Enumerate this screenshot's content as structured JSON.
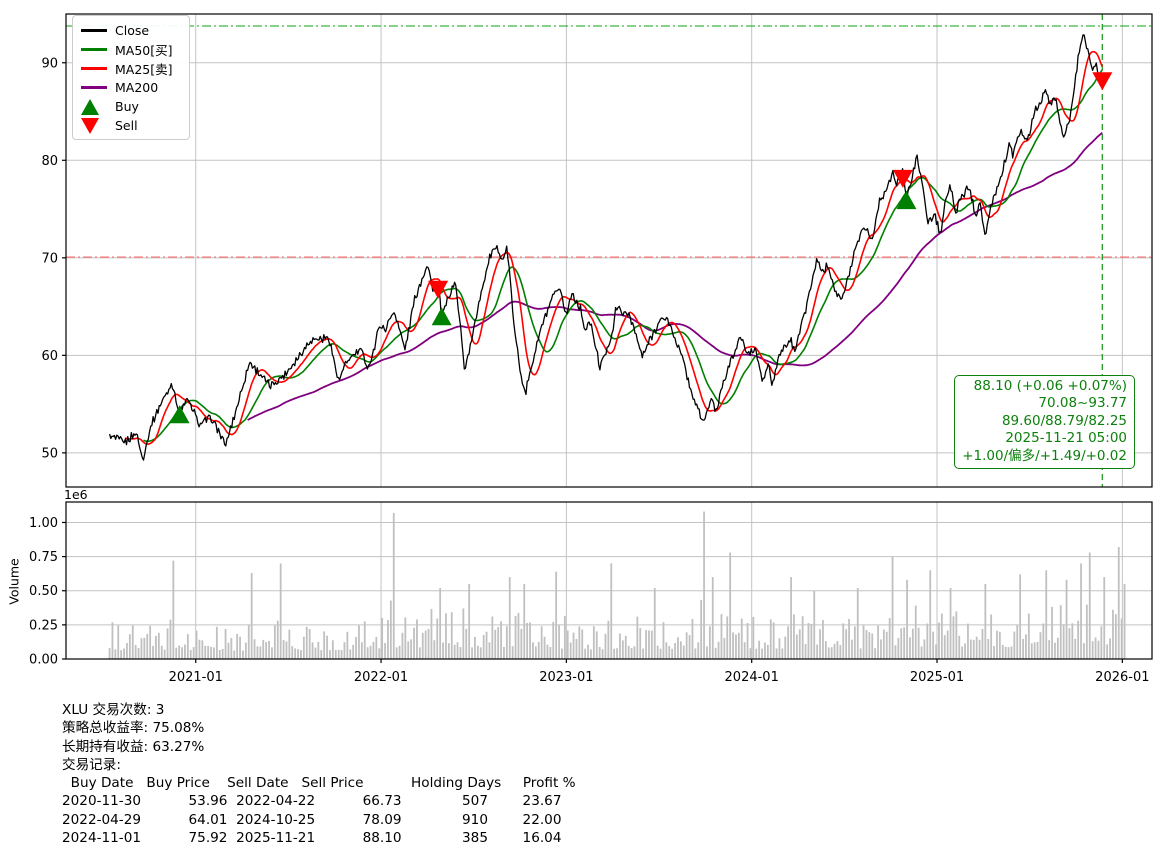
{
  "figure": {
    "bg": "#ffffff"
  },
  "colors": {
    "close": "#000000",
    "ma25": "#ff0000",
    "ma50": "#008000",
    "ma200": "#800080",
    "buy": "#008000",
    "sell": "#ff0000",
    "hline_top": "#00a000",
    "hline_mid": "#ff4040",
    "vline": "#0a8f0a",
    "volume_bar": "#c0c0c0",
    "grid": "#c3c3c3",
    "annotation": "#0d800d"
  },
  "legend": {
    "items": [
      {
        "label": "Close",
        "color": "#000000",
        "type": "line"
      },
      {
        "label": "MA50[买]",
        "color": "#008000",
        "type": "line"
      },
      {
        "label": "MA25[卖]",
        "color": "#ff0000",
        "type": "line"
      },
      {
        "label": "MA200",
        "color": "#800080",
        "type": "line"
      },
      {
        "label": "Buy",
        "color": "#008000",
        "type": "triangle-up"
      },
      {
        "label": "Sell",
        "color": "#ff0000",
        "type": "triangle-down"
      }
    ]
  },
  "annotation": {
    "color": "#0d800d",
    "lines": [
      "88.10 (+0.06 +0.07%)",
      "70.08~93.77",
      "89.60/88.79/82.25",
      "2025-11-21 05:00",
      "+1.00/偏多/+1.49/+0.02"
    ]
  },
  "summary": {
    "lines": [
      "XLU 交易次数: 3",
      "策略总收益率: 75.08%",
      "长期持有收益: 63.27%",
      "交易记录:"
    ]
  },
  "trades": {
    "columns": [
      "Buy Date",
      "Buy Price",
      "Sell Date",
      "Sell Price",
      "Holding Days",
      "Profit %"
    ],
    "rows": [
      [
        "2020-11-30",
        "53.96",
        "2022-04-22",
        "66.73",
        "507",
        "23.67"
      ],
      [
        "2022-04-29",
        "64.01",
        "2024-10-25",
        "78.09",
        "910",
        "22.00"
      ],
      [
        "2024-11-01",
        "75.92",
        "2025-11-21",
        "88.10",
        "385",
        "16.04"
      ]
    ],
    "header_text": "  Buy Date   Buy Price    Sell Date   Sell Price           Holding Days     Profit %",
    "row_texts": [
      "2020-11-30           53.96  2022-04-22           66.73              507        23.67",
      "2022-04-29           64.01  2024-10-25           78.09              910        22.00",
      "2024-11-01           75.92  2025-11-21           88.10              385        16.04"
    ]
  },
  "chart_data": [
    {
      "type": "line",
      "title": "",
      "xlabel": "",
      "ylabel": "",
      "xlim": [
        2020.3,
        2026.16
      ],
      "ylim": [
        46.5,
        95.0
      ],
      "grid": true,
      "legend_position": "upper-left",
      "x_ticks": [
        {
          "pos": 2021,
          "label": "2021-01"
        },
        {
          "pos": 2022,
          "label": "2022-01"
        },
        {
          "pos": 2023,
          "label": "2023-01"
        },
        {
          "pos": 2024,
          "label": "2024-01"
        },
        {
          "pos": 2025,
          "label": "2025-01"
        },
        {
          "pos": 2026,
          "label": "2026-01"
        }
      ],
      "y_ticks": [
        50,
        60,
        70,
        80,
        90
      ],
      "hlines": [
        {
          "y": 93.77,
          "style": "dashdot",
          "color": "#00a000"
        },
        {
          "y": 70.08,
          "style": "dashdot",
          "color": "#ff4040"
        }
      ],
      "vlines": [
        {
          "x": 2025.892,
          "style": "dashed",
          "color": "#0a8f0a"
        }
      ],
      "markers": {
        "buy": [
          [
            2020.913,
            53.96
          ],
          [
            2022.327,
            64.01
          ],
          [
            2024.835,
            75.92
          ]
        ],
        "sell": [
          [
            2022.308,
            66.73
          ],
          [
            2024.816,
            78.09
          ],
          [
            2025.892,
            88.1
          ]
        ]
      },
      "series": [
        {
          "name": "Close",
          "color": "#000000",
          "width": 1.3,
          "anchors": [
            [
              2020.535,
              51.7
            ],
            [
              2020.62,
              51.1
            ],
            [
              2020.68,
              52.1
            ],
            [
              2020.713,
              49.3
            ],
            [
              2020.76,
              52.9
            ],
            [
              2020.81,
              55.0
            ],
            [
              2020.855,
              56.5
            ],
            [
              2020.87,
              57.3
            ],
            [
              2020.913,
              53.96
            ],
            [
              2020.95,
              55.5
            ],
            [
              2020.98,
              54.6
            ],
            [
              2021.02,
              52.9
            ],
            [
              2021.08,
              53.6
            ],
            [
              2021.12,
              52.4
            ],
            [
              2021.16,
              50.7
            ],
            [
              2021.21,
              53.9
            ],
            [
              2021.29,
              59.3
            ],
            [
              2021.36,
              57.8
            ],
            [
              2021.4,
              56.8
            ],
            [
              2021.48,
              58.0
            ],
            [
              2021.56,
              60.0
            ],
            [
              2021.62,
              61.6
            ],
            [
              2021.72,
              61.8
            ],
            [
              2021.77,
              57.3
            ],
            [
              2021.82,
              59.5
            ],
            [
              2021.89,
              60.6
            ],
            [
              2021.93,
              58.7
            ],
            [
              2021.97,
              61.1
            ],
            [
              2021.99,
              63.2
            ],
            [
              2022.02,
              62.6
            ],
            [
              2022.07,
              64.6
            ],
            [
              2022.1,
              62.6
            ],
            [
              2022.13,
              60.6
            ],
            [
              2022.18,
              65.7
            ],
            [
              2022.25,
              69.4
            ],
            [
              2022.28,
              66.7
            ],
            [
              2022.308,
              67.2
            ],
            [
              2022.327,
              63.9
            ],
            [
              2022.36,
              65.7
            ],
            [
              2022.4,
              67.7
            ],
            [
              2022.43,
              62.6
            ],
            [
              2022.45,
              58.5
            ],
            [
              2022.49,
              61.6
            ],
            [
              2022.53,
              65.7
            ],
            [
              2022.59,
              70.3
            ],
            [
              2022.63,
              71.0
            ],
            [
              2022.66,
              69.7
            ],
            [
              2022.68,
              71.2
            ],
            [
              2022.72,
              62.6
            ],
            [
              2022.75,
              58.5
            ],
            [
              2022.78,
              56.2
            ],
            [
              2022.82,
              59.5
            ],
            [
              2022.86,
              62.6
            ],
            [
              2022.9,
              64.6
            ],
            [
              2022.94,
              66.5
            ],
            [
              2022.97,
              66.4
            ],
            [
              2023.0,
              64.1
            ],
            [
              2023.03,
              66.4
            ],
            [
              2023.08,
              64.6
            ],
            [
              2023.1,
              62.6
            ],
            [
              2023.13,
              63.4
            ],
            [
              2023.18,
              58.8
            ],
            [
              2023.22,
              60.6
            ],
            [
              2023.25,
              62.6
            ],
            [
              2023.27,
              65.0
            ],
            [
              2023.32,
              64.1
            ],
            [
              2023.34,
              64.3
            ],
            [
              2023.39,
              61.1
            ],
            [
              2023.41,
              59.8
            ],
            [
              2023.45,
              61.6
            ],
            [
              2023.5,
              63.4
            ],
            [
              2023.54,
              63.9
            ],
            [
              2023.59,
              61.6
            ],
            [
              2023.63,
              59.5
            ],
            [
              2023.67,
              56.5
            ],
            [
              2023.71,
              54.4
            ],
            [
              2023.74,
              53.1
            ],
            [
              2023.78,
              55.5
            ],
            [
              2023.81,
              54.2
            ],
            [
              2023.84,
              57.0
            ],
            [
              2023.89,
              59.5
            ],
            [
              2023.94,
              61.9
            ],
            [
              2023.98,
              60.1
            ],
            [
              2024.02,
              60.6
            ],
            [
              2024.06,
              57.2
            ],
            [
              2024.09,
              59.2
            ],
            [
              2024.11,
              56.8
            ],
            [
              2024.15,
              60.1
            ],
            [
              2024.21,
              61.6
            ],
            [
              2024.23,
              60.5
            ],
            [
              2024.29,
              64.6
            ],
            [
              2024.35,
              69.7
            ],
            [
              2024.39,
              68.5
            ],
            [
              2024.41,
              69.5
            ],
            [
              2024.45,
              66.7
            ],
            [
              2024.49,
              65.7
            ],
            [
              2024.53,
              68.7
            ],
            [
              2024.57,
              71.8
            ],
            [
              2024.61,
              73.3
            ],
            [
              2024.65,
              71.8
            ],
            [
              2024.69,
              75.9
            ],
            [
              2024.74,
              77.4
            ],
            [
              2024.76,
              78.9
            ],
            [
              2024.78,
              77.4
            ],
            [
              2024.816,
              79.2
            ],
            [
              2024.835,
              76.2
            ],
            [
              2024.87,
              78.4
            ],
            [
              2024.89,
              80.9
            ],
            [
              2024.92,
              77.4
            ],
            [
              2024.95,
              73.8
            ],
            [
              2024.99,
              74.3
            ],
            [
              2025.02,
              72.3
            ],
            [
              2025.04,
              75.4
            ],
            [
              2025.07,
              77.4
            ],
            [
              2025.1,
              74.8
            ],
            [
              2025.14,
              76.4
            ],
            [
              2025.17,
              77.4
            ],
            [
              2025.21,
              74.3
            ],
            [
              2025.23,
              75.9
            ],
            [
              2025.26,
              72.1
            ],
            [
              2025.3,
              75.9
            ],
            [
              2025.34,
              77.9
            ],
            [
              2025.39,
              81.7
            ],
            [
              2025.41,
              80.5
            ],
            [
              2025.45,
              83.0
            ],
            [
              2025.49,
              82.0
            ],
            [
              2025.53,
              85.1
            ],
            [
              2025.59,
              87.1
            ],
            [
              2025.61,
              85.6
            ],
            [
              2025.64,
              86.3
            ],
            [
              2025.68,
              82.3
            ],
            [
              2025.72,
              84.5
            ],
            [
              2025.76,
              90.2
            ],
            [
              2025.79,
              93.3
            ],
            [
              2025.82,
              90.7
            ],
            [
              2025.84,
              89.2
            ],
            [
              2025.86,
              90.0
            ],
            [
              2025.875,
              88.6
            ],
            [
              2025.892,
              88.1
            ]
          ]
        },
        {
          "name": "MA25[卖]",
          "color": "#ff0000",
          "width": 1.6,
          "derived": "ma",
          "window_days": 35,
          "end_value": 89.6
        },
        {
          "name": "MA50[买]",
          "color": "#008000",
          "width": 1.6,
          "derived": "ma",
          "window_days": 70,
          "end_value": 88.79
        },
        {
          "name": "MA200",
          "color": "#800080",
          "width": 1.8,
          "derived": "ma",
          "window_days": 280,
          "end_value": 82.25
        }
      ]
    },
    {
      "type": "bar",
      "ylabel": "Volume",
      "scale_label": "1e6",
      "xlim": [
        2020.3,
        2026.16
      ],
      "ylim": [
        0,
        1.15
      ],
      "bar_color": "#c0c0c0",
      "y_ticks": [
        "0.00",
        "0.25",
        "0.50",
        "0.75",
        "1.00"
      ],
      "x_range_bars": [
        2020.535,
        2026.02
      ],
      "envelope": [
        [
          2020.53,
          0.13
        ],
        [
          2021.2,
          0.12
        ],
        [
          2021.8,
          0.13
        ],
        [
          2022.1,
          0.17
        ],
        [
          2022.6,
          0.17
        ],
        [
          2023.1,
          0.14
        ],
        [
          2023.6,
          0.15
        ],
        [
          2024.0,
          0.15
        ],
        [
          2024.6,
          0.15
        ],
        [
          2024.9,
          0.18
        ],
        [
          2025.3,
          0.16
        ],
        [
          2025.7,
          0.2
        ],
        [
          2026.02,
          0.22
        ]
      ],
      "spikes": [
        [
          2020.876,
          0.72
        ],
        [
          2021.297,
          0.63
        ],
        [
          2021.464,
          0.7
        ],
        [
          2022.07,
          1.07
        ],
        [
          2022.317,
          0.52
        ],
        [
          2022.48,
          0.55
        ],
        [
          2022.695,
          0.6
        ],
        [
          2022.776,
          0.55
        ],
        [
          2022.954,
          0.64
        ],
        [
          2023.246,
          0.7
        ],
        [
          2023.478,
          0.52
        ],
        [
          2023.748,
          1.08
        ],
        [
          2023.79,
          0.6
        ],
        [
          2023.888,
          0.78
        ],
        [
          2024.22,
          0.6
        ],
        [
          2024.35,
          0.5
        ],
        [
          2024.585,
          0.52
        ],
        [
          2024.763,
          0.75
        ],
        [
          2024.838,
          0.58
        ],
        [
          2024.973,
          0.65
        ],
        [
          2025.08,
          0.52
        ],
        [
          2025.27,
          0.55
        ],
        [
          2025.46,
          0.62
        ],
        [
          2025.6,
          0.65
        ],
        [
          2025.71,
          0.58
        ],
        [
          2025.78,
          0.7
        ],
        [
          2025.83,
          0.78
        ],
        [
          2025.91,
          0.6
        ],
        [
          2025.985,
          0.82
        ],
        [
          2026.02,
          0.55
        ]
      ]
    }
  ]
}
